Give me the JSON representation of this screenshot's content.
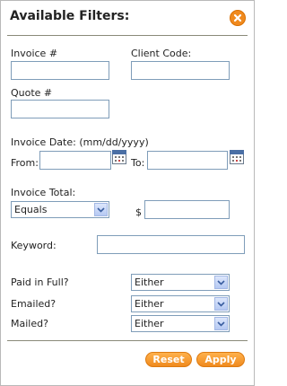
{
  "panel": {
    "title": "Available Filters:"
  },
  "fields": {
    "invoice_no": {
      "label": "Invoice #",
      "value": ""
    },
    "client_code": {
      "label": "Client Code:",
      "value": ""
    },
    "quote_no": {
      "label": "Quote #",
      "value": ""
    },
    "invoice_date": {
      "label": "Invoice Date: (mm/dd/yyyy)",
      "from_label": "From:",
      "to_label": "To:",
      "from_value": "",
      "to_value": ""
    },
    "invoice_total": {
      "label": "Invoice Total:",
      "operator": "Equals",
      "currency": "$",
      "value": ""
    },
    "keyword": {
      "label": "Keyword:",
      "value": ""
    },
    "paid_in_full": {
      "label": "Paid in Full?",
      "value": "Either"
    },
    "emailed": {
      "label": "Emailed?",
      "value": "Either"
    },
    "mailed": {
      "label": "Mailed?",
      "value": "Either"
    }
  },
  "buttons": {
    "reset": "Reset",
    "apply": "Apply"
  },
  "icons": {
    "close": "close-icon",
    "calendar": "calendar-icon",
    "dropdown": "chevron-down-icon"
  },
  "colors": {
    "accent": "#f08a1e",
    "input_border": "#7f9db9"
  }
}
